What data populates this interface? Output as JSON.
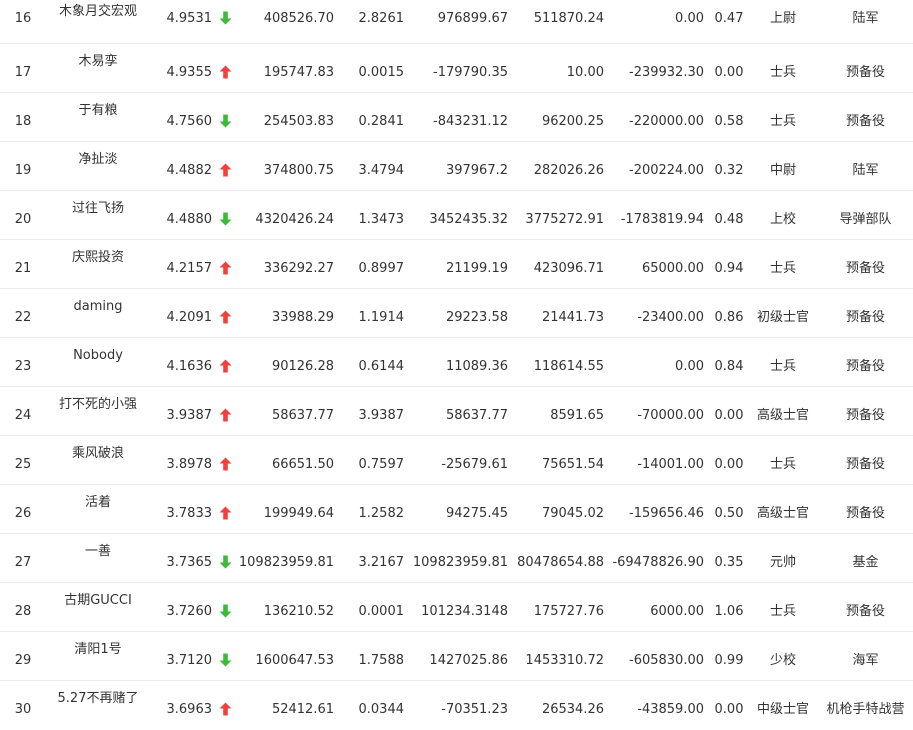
{
  "colors": {
    "up": "#f0413c",
    "down": "#3cbb3a",
    "text": "#333333",
    "row_border": "#e8ecf2"
  },
  "table": {
    "rows": [
      {
        "rank": "16",
        "name": "木象月交宏观",
        "score": "4.9531",
        "trend": "down",
        "v1": "408526.70",
        "v2": "2.8261",
        "v3": "976899.67",
        "v4": "511870.24",
        "v5": "0.00",
        "v6": "0.47",
        "military_rank": "上尉",
        "unit": "陆军"
      },
      {
        "rank": "17",
        "name": "木易孪",
        "score": "4.9355",
        "trend": "up",
        "v1": "195747.83",
        "v2": "0.0015",
        "v3": "-179790.35",
        "v4": "10.00",
        "v5": "-239932.30",
        "v6": "0.00",
        "military_rank": "士兵",
        "unit": "预备役"
      },
      {
        "rank": "18",
        "name": "于有粮",
        "score": "4.7560",
        "trend": "down",
        "v1": "254503.83",
        "v2": "0.2841",
        "v3": "-843231.12",
        "v4": "96200.25",
        "v5": "-220000.00",
        "v6": "0.58",
        "military_rank": "士兵",
        "unit": "预备役"
      },
      {
        "rank": "19",
        "name": "净扯淡",
        "score": "4.4882",
        "trend": "up",
        "v1": "374800.75",
        "v2": "3.4794",
        "v3": "397967.2",
        "v4": "282026.26",
        "v5": "-200224.00",
        "v6": "0.32",
        "military_rank": "中尉",
        "unit": "陆军"
      },
      {
        "rank": "20",
        "name": "过往飞扬",
        "score": "4.4880",
        "trend": "down",
        "v1": "4320426.24",
        "v2": "1.3473",
        "v3": "3452435.32",
        "v4": "3775272.91",
        "v5": "-1783819.94",
        "v6": "0.48",
        "military_rank": "上校",
        "unit": "导弹部队"
      },
      {
        "rank": "21",
        "name": "庆熙投资",
        "score": "4.2157",
        "trend": "up",
        "v1": "336292.27",
        "v2": "0.8997",
        "v3": "21199.19",
        "v4": "423096.71",
        "v5": "65000.00",
        "v6": "0.94",
        "military_rank": "士兵",
        "unit": "预备役"
      },
      {
        "rank": "22",
        "name": "daming",
        "score": "4.2091",
        "trend": "up",
        "v1": "33988.29",
        "v2": "1.1914",
        "v3": "29223.58",
        "v4": "21441.73",
        "v5": "-23400.00",
        "v6": "0.86",
        "military_rank": "初级士官",
        "unit": "预备役"
      },
      {
        "rank": "23",
        "name": "Nobody",
        "score": "4.1636",
        "trend": "up",
        "v1": "90126.28",
        "v2": "0.6144",
        "v3": "11089.36",
        "v4": "118614.55",
        "v5": "0.00",
        "v6": "0.84",
        "military_rank": "士兵",
        "unit": "预备役"
      },
      {
        "rank": "24",
        "name": "打不死的小强",
        "score": "3.9387",
        "trend": "up",
        "v1": "58637.77",
        "v2": "3.9387",
        "v3": "58637.77",
        "v4": "8591.65",
        "v5": "-70000.00",
        "v6": "0.00",
        "military_rank": "高级士官",
        "unit": "预备役"
      },
      {
        "rank": "25",
        "name": "乘风破浪",
        "score": "3.8978",
        "trend": "up",
        "v1": "66651.50",
        "v2": "0.7597",
        "v3": "-25679.61",
        "v4": "75651.54",
        "v5": "-14001.00",
        "v6": "0.00",
        "military_rank": "士兵",
        "unit": "预备役"
      },
      {
        "rank": "26",
        "name": "活着",
        "score": "3.7833",
        "trend": "up",
        "v1": "199949.64",
        "v2": "1.2582",
        "v3": "94275.45",
        "v4": "79045.02",
        "v5": "-159656.46",
        "v6": "0.50",
        "military_rank": "高级士官",
        "unit": "预备役"
      },
      {
        "rank": "27",
        "name": "一善",
        "score": "3.7365",
        "trend": "down",
        "v1": "109823959.81",
        "v2": "3.2167",
        "v3": "109823959.81",
        "v4": "80478654.88",
        "v5": "-69478826.90",
        "v6": "0.35",
        "military_rank": "元帅",
        "unit": "基金"
      },
      {
        "rank": "28",
        "name": "古期GUCCI",
        "score": "3.7260",
        "trend": "down",
        "v1": "136210.52",
        "v2": "0.0001",
        "v3": "101234.3148",
        "v4": "175727.76",
        "v5": "6000.00",
        "v6": "1.06",
        "military_rank": "士兵",
        "unit": "预备役"
      },
      {
        "rank": "29",
        "name": "清阳1号",
        "score": "3.7120",
        "trend": "down",
        "v1": "1600647.53",
        "v2": "1.7588",
        "v3": "1427025.86",
        "v4": "1453310.72",
        "v5": "-605830.00",
        "v6": "0.99",
        "military_rank": "少校",
        "unit": "海军"
      },
      {
        "rank": "30",
        "name": "5.27不再赌了",
        "score": "3.6963",
        "trend": "up",
        "v1": "52412.61",
        "v2": "0.0344",
        "v3": "-70351.23",
        "v4": "26534.26",
        "v5": "-43859.00",
        "v6": "0.00",
        "military_rank": "中级士官",
        "unit": "机枪手特战营"
      }
    ]
  }
}
